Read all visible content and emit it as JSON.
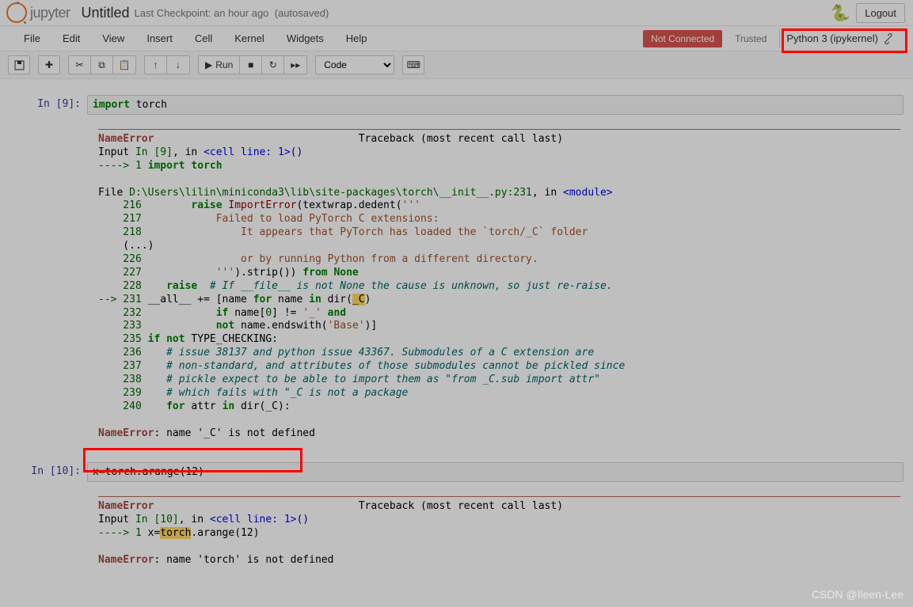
{
  "header": {
    "logo_text": "jupyter",
    "notebook_title": "Untitled",
    "checkpoint": "Last Checkpoint: an hour ago",
    "autosaved": "(autosaved)",
    "logout": "Logout"
  },
  "menubar": {
    "items": [
      "File",
      "Edit",
      "View",
      "Insert",
      "Cell",
      "Kernel",
      "Widgets",
      "Help"
    ],
    "not_connected": "Not Connected",
    "trusted": "Trusted",
    "kernel": "Python 3 (ipykernel)"
  },
  "toolbar": {
    "run_label": "Run",
    "cell_type": "Code"
  },
  "cells": [
    {
      "prompt_in": "In  [9]:",
      "code_kw": "import",
      "code_rest": " torch",
      "traceback": {
        "err_name": "NameError",
        "traceback_label": "Traceback (most recent call last)",
        "input_label": "Input ",
        "input_in": "In [9]",
        "input_rest": ", in ",
        "cell_line": "<cell line: 1>",
        "parens": "()",
        "arrow_1": "----> 1 ",
        "line1_kw": "import",
        "line1_rest": " torch",
        "file_label": "File ",
        "file_path": "D:\\Users\\lilin\\miniconda3\\lib\\site-packages\\torch\\__init__.py:231",
        "file_in": ", in ",
        "module": "<module>",
        "lines": {
          "216": {
            "pad": "        ",
            "content": "raise ImportError(textwrap.dedent('''"
          },
          "217": {
            "pad": "            ",
            "content": "Failed to load PyTorch C extensions:"
          },
          "218": {
            "pad": "                ",
            "content": "It appears that PyTorch has loaded the `torch/_C` folder"
          },
          "dots": "    (...)",
          "226": {
            "pad": "                ",
            "content": "or by running Python from a different directory."
          },
          "227": {
            "pad": "            ",
            "content": "''').strip()) from None"
          },
          "228": {
            "pad": "    ",
            "content": "raise  # If __file__ is not None the cause is unknown, so just re-raise."
          },
          "231_arrow": "--> 231 ",
          "231": "__all__ += [name for name in dir(_C)",
          "232": {
            "pad": "            ",
            "content": "if name[0] != '_' and"
          },
          "233": {
            "pad": "            ",
            "content": "not name.endswith('Base')]"
          },
          "235": {
            "pad": "",
            "content": "if not TYPE_CHECKING:"
          },
          "236": {
            "pad": "    ",
            "content": "# issue 38137 and python issue 43367. Submodules of a C extension are"
          },
          "237": {
            "pad": "    ",
            "content": "# non-standard, and attributes of those submodules cannot be pickled since"
          },
          "238": {
            "pad": "    ",
            "content": "# pickle expect to be able to import them as \"from _C.sub import attr\""
          },
          "239": {
            "pad": "    ",
            "content": "# which fails with \"_C is not a package"
          },
          "240": {
            "pad": "    ",
            "content": "for attr in dir(_C):"
          }
        },
        "final_err": "NameError",
        "final_msg": ": name '_C' is not defined"
      }
    },
    {
      "prompt_in": "In [10]:",
      "code_line": "x=torch.arange(12)",
      "traceback": {
        "err_name": "NameError",
        "traceback_label": "Traceback (most recent call last)",
        "input_label": "Input ",
        "input_in": "In [10]",
        "input_rest": ", in ",
        "cell_line": "<cell line: 1>",
        "parens": "()",
        "arrow_1": "----> 1 ",
        "line1_pre": "x=",
        "line1_hl": "torch",
        "line1_post": ".arange(12)",
        "final_err": "NameError",
        "final_msg": ": name 'torch' is not defined"
      }
    }
  ],
  "watermark": "CSDN @Ileen-Lee"
}
